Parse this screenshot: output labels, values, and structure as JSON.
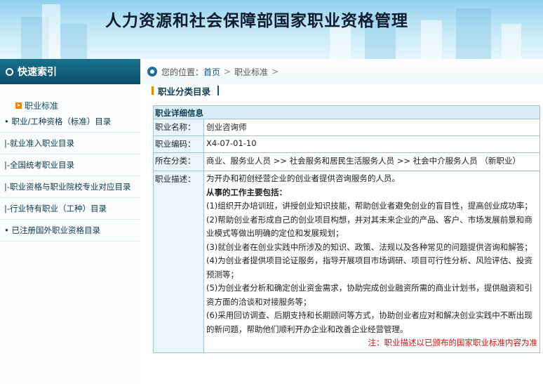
{
  "header": {
    "title": "人力资源和社会保障部国家职业资格管理"
  },
  "sidebar": {
    "heading": "快速索引",
    "category": "职业标准",
    "items": [
      {
        "label": "• 职业/工种资格（标准）目录"
      },
      {
        "label": "|-就业准入职业目录"
      },
      {
        "label": "|-全国统考职业目录"
      },
      {
        "label": "|-职业资格与职业院校专业对应目录"
      },
      {
        "label": "|-行业特有职业（工种）目录"
      },
      {
        "label": "• 已注册国外职业资格目录"
      }
    ]
  },
  "breadcrumb": {
    "prefix": "您的位置：",
    "home": "首页",
    "sep1": ">",
    "current": "职业标准",
    "sep2": ">"
  },
  "section": {
    "title": "职业分类目录"
  },
  "detail": {
    "heading": "职业详细信息",
    "name_label": "职业名称：",
    "name_value": "创业咨询师",
    "code_label": "职业编码：",
    "code_value": "X4-07-01-10",
    "category_label": "所在分类：",
    "category_value": "商业、服务业人员 >> 社会服务和居民生活服务人员 >> 社会中介服务人员 （新职业）",
    "desc_label": "职业描述：",
    "desc_intro": "为开办和初创经营企业的创业者提供咨询服务的人员。",
    "desc_work_heading": "从事的工作主要包括：",
    "desc_items": [
      "(1)组织开办培训班，讲授创业知识技能，帮助创业者避免创业的盲目性，提高创业成功率；",
      "(2)帮助创业者形成自己的创业项目构想，并对其未来企业的产品、客户、市场发展前景和商业模式等做出明确的定位和发展规划；",
      "(3)就创业者在创业实践中所涉及的知识、政策、法规以及各种常见的问题提供咨询和解答；",
      "(4)为创业者提供项目论证服务，指导开展项目市场调研、项目可行性分析、风险评估、投资预测等；",
      "(5)为创业者分析和确定创业资金需求，协助完成创业融资所需的商业计划书，提供融资和引资方面的洽谈和对接服务等；",
      "(6)采用回访调查、后期支持和长期顾问等方式，协助创业者应对和解决创业实践中不断出现的新问题，帮助他们顺利开办企业和改善企业经营管理。"
    ],
    "desc_note": "注：职业描述以已颁布的国家职业标准内容为准"
  }
}
